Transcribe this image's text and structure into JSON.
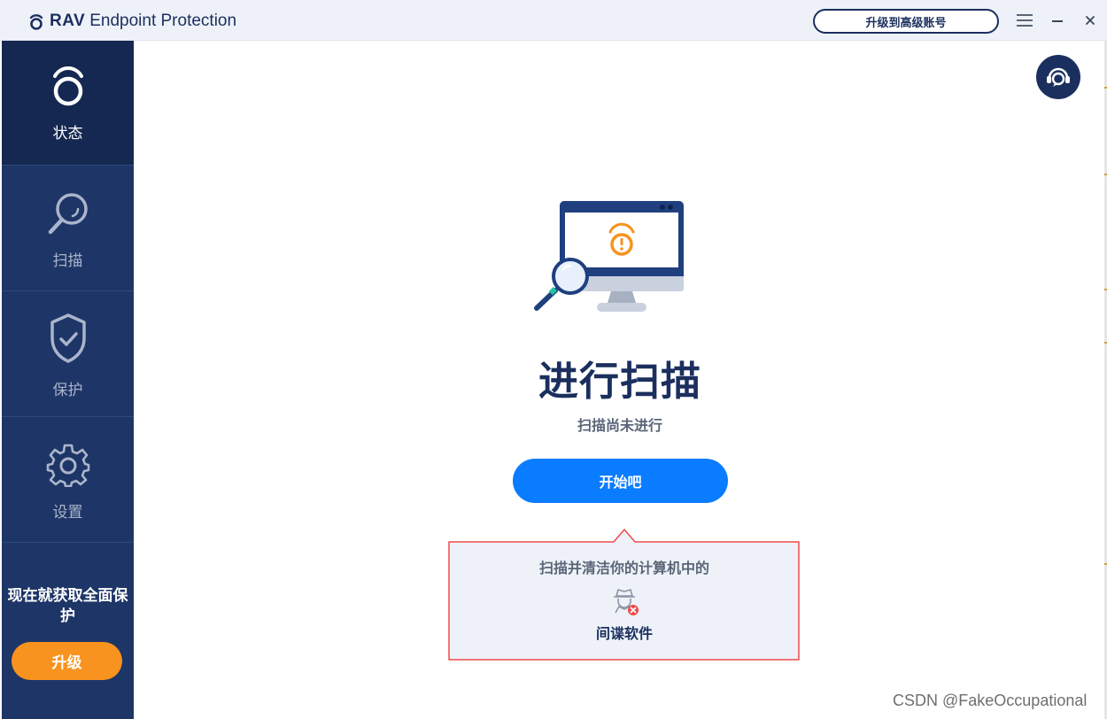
{
  "app": {
    "title_strong": "RAV",
    "title_rest": "Endpoint Protection",
    "upgrade_account_label": "升级到高级账号"
  },
  "sidebar": {
    "items": [
      {
        "label": "状态",
        "icon": "status-ring-icon",
        "active": true
      },
      {
        "label": "扫描",
        "icon": "magnifier-icon",
        "active": false
      },
      {
        "label": "保护",
        "icon": "shield-check-icon",
        "active": false
      },
      {
        "label": "设置",
        "icon": "gear-icon",
        "active": false
      }
    ],
    "promo_text": "现在就获取全面保护",
    "promo_button": "升级"
  },
  "main": {
    "title": "进行扫描",
    "subtitle": "扫描尚未进行",
    "start_button": "开始吧",
    "tooltip": {
      "line1": "扫描并清洁你的计算机中的",
      "line2": "间谍软件",
      "icon": "spy-icon"
    }
  },
  "watermark": "CSDN @FakeOccupational",
  "colors": {
    "navy": "#1b2f5e",
    "sidebar": "#1e3567",
    "sidebar_active": "#142851",
    "accent_orange": "#f7931e",
    "primary_blue": "#0a7cff",
    "tooltip_border": "#f04a4a"
  }
}
